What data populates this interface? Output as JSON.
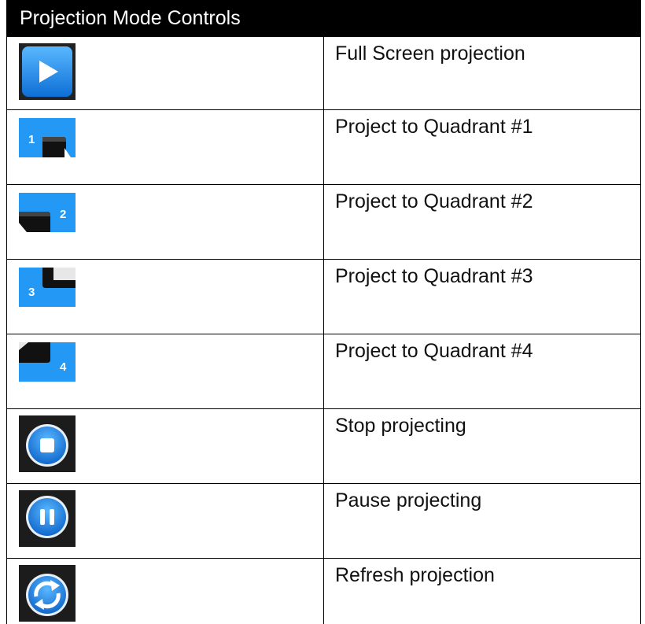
{
  "table": {
    "title": "Projection Mode Controls",
    "rows": [
      {
        "icon": "play-icon",
        "label": "Full Screen projection"
      },
      {
        "icon": "quadrant-1-icon",
        "label": "Project to Quadrant #1",
        "badge": "1"
      },
      {
        "icon": "quadrant-2-icon",
        "label": "Project to Quadrant #2",
        "badge": "2"
      },
      {
        "icon": "quadrant-3-icon",
        "label": "Project to Quadrant #3",
        "badge": "3"
      },
      {
        "icon": "quadrant-4-icon",
        "label": "Project to Quadrant #4",
        "badge": "4"
      },
      {
        "icon": "stop-icon",
        "label": "Stop projecting"
      },
      {
        "icon": "pause-icon",
        "label": "Pause projecting"
      },
      {
        "icon": "refresh-icon",
        "label": "Refresh projection"
      }
    ]
  },
  "colors": {
    "accent_blue": "#1e8ff0",
    "dark_bg": "#1c1c1c"
  }
}
